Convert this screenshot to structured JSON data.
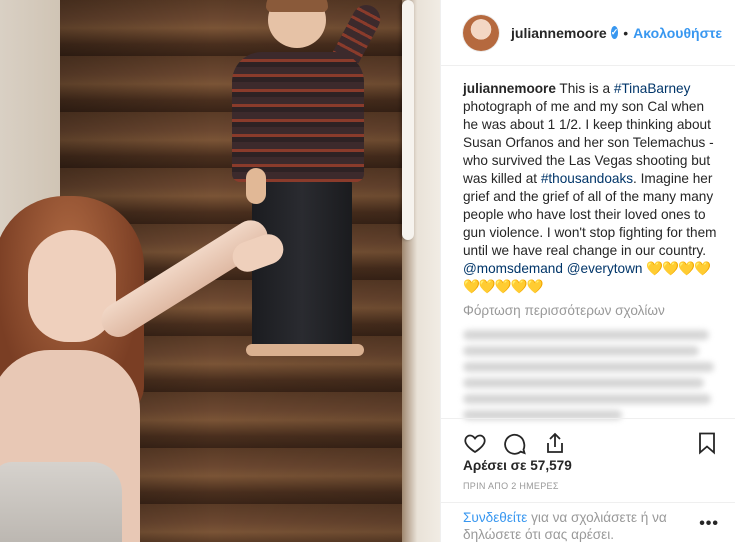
{
  "post": {
    "username": "juliannemoore",
    "verified_mark": "✓",
    "separator": "•",
    "follow_label": "Ακολουθήστε",
    "caption": {
      "username": "juliannemoore",
      "text_1": " This is a ",
      "hashtag_1": "#TinaBarney",
      "text_2": " photograph of me and my son Cal when he was about 1 1/2. I keep thinking about Susan Orfanos and her son Telemachus - who survived the Las Vegas shooting but was killed at ",
      "hashtag_2": "#thousandoaks",
      "text_3": ". Imagine her grief and the grief of all of the many many people who have lost their loved ones to gun violence. I won't stop fighting for them until we have real change in our country. ",
      "mention_1": "@momsdemand",
      "mention_2": "@everytown",
      "hearts": "💛💛💛💛💛💛💛💛💛"
    },
    "load_more_comments": "Φόρτωση περισσότερων σχολίων",
    "likes": "Αρέσει σε 57,579",
    "timestamp": "ΠΡΙΝ ΑΠΟ 2 ΗΜΕΡΕΣ",
    "login_link": "Συνδεθείτε",
    "login_text": " για να σχολιάσετε ή να δηλώσετε ότι σας αρέσει.",
    "more_options": "•••"
  },
  "icons": {
    "like": "heart-icon",
    "comment": "comment-icon",
    "share": "share-icon",
    "save": "bookmark-icon"
  },
  "colors": {
    "accent": "#3897f0",
    "hashtag": "#003569",
    "muted": "#999999",
    "text": "#262626",
    "heart_emoji": "#fdb913"
  }
}
